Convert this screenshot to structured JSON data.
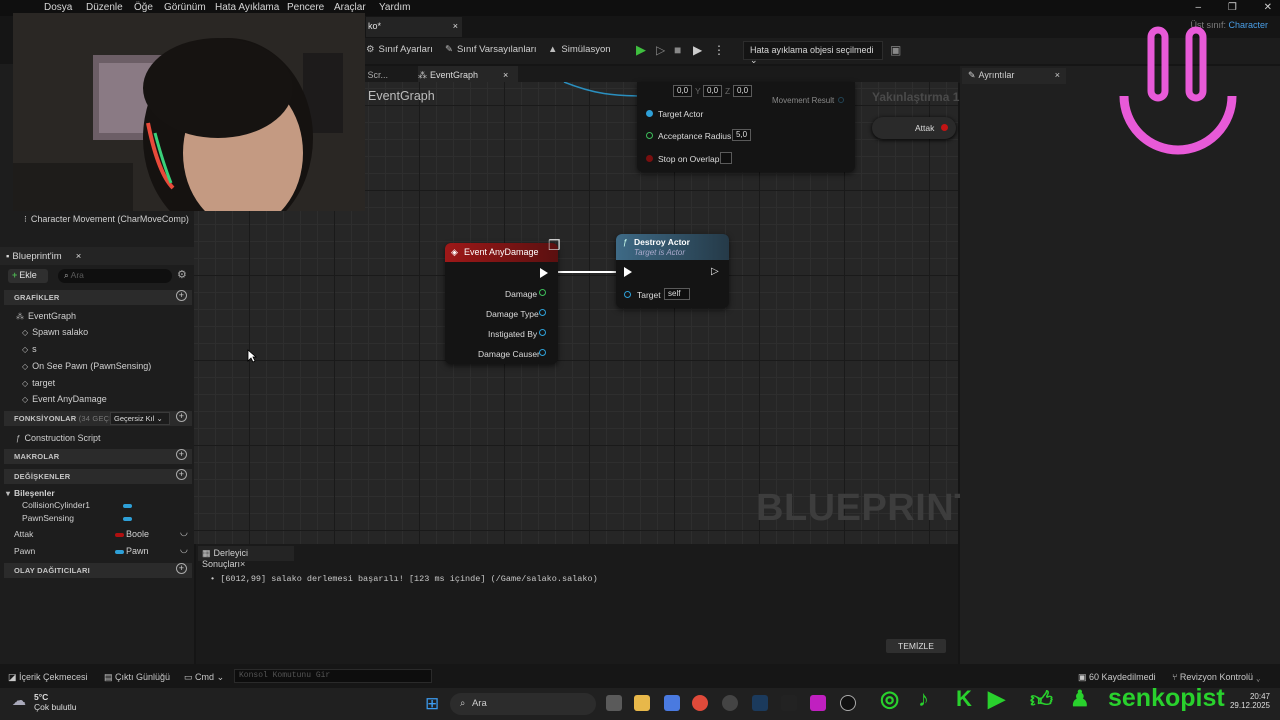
{
  "menu": [
    "Dosya",
    "Düzenle",
    "Öğe",
    "Görünüm",
    "Hata Ayıklama",
    "Pencere",
    "Araçlar",
    "Yardım"
  ],
  "window_controls": [
    "–",
    "❐",
    "✕"
  ],
  "parent_class": {
    "label": "Üst sınıf:",
    "value": "Character"
  },
  "doc_tab": {
    "label": "ko*",
    "close": "×"
  },
  "toolbar": {
    "class_settings": "Sınıf Ayarları",
    "class_defaults": "Sınıf Varsayılanları",
    "simulation": "Simülasyon",
    "debug_object": "Hata ayıklama objesi seçilmedi"
  },
  "graph_tabs": {
    "construction": "n Scr...",
    "active": "EventGraph",
    "close": "×"
  },
  "graph": {
    "title": "EventGraph",
    "zoom": "Yakınlaştırma 1:1",
    "watermark": "BLUEPRINT"
  },
  "nodes": {
    "move_to": {
      "coords": [
        "0,0",
        "0,0",
        "0,0"
      ],
      "coord_axes": [
        "X",
        "Y",
        "Z"
      ],
      "movement_result": "Movement Result",
      "target_actor": "Target Actor",
      "acceptance_radius": "Acceptance Radius",
      "acceptance_value": "5,0",
      "stop_on_overlap": "Stop on Overlap"
    },
    "attak": "Attak",
    "event_any_damage": {
      "title": "Event AnyDamage",
      "pins": [
        "Damage",
        "Damage Type",
        "Instigated By",
        "Damage Causer"
      ]
    },
    "destroy_actor": {
      "title": "Destroy Actor",
      "subtitle": "Target is Actor",
      "target_label": "Target",
      "target_value": "self"
    }
  },
  "left": {
    "component": "Character Movement (CharMoveComp)",
    "bp_tab": "Blueprint'im",
    "add": "Ekle",
    "search_placeholder": "Ara",
    "sections": {
      "graphs": "GRAFİKLER",
      "functions": "FONKSİYONLAR",
      "functions_count": "(34 GEÇERSİ",
      "functions_filter": "Geçersiz Kıl",
      "macros": "MAKROLAR",
      "variables": "DEĞİŞKENLER",
      "dispatchers": "OLAY DAĞITICILARI"
    },
    "graph_items": [
      "EventGraph",
      "Spawn salako",
      "s",
      "On See Pawn (PawnSensing)",
      "target",
      "Event AnyDamage"
    ],
    "function_items": [
      "Construction Script"
    ],
    "components_group": "Bileşenler",
    "components": [
      "CollisionCylinder1",
      "PawnSensing"
    ],
    "variables": [
      {
        "name": "Attak",
        "type": "Boole",
        "color": "#b01010"
      },
      {
        "name": "Pawn",
        "type": "Pawn",
        "color": "#2ea0d8"
      }
    ]
  },
  "details": {
    "tab": "Ayrıntılar",
    "close": "×"
  },
  "output": {
    "tab": "Derleyici Sonuçları",
    "close": "×",
    "log": "[6012,99] salako derlemesi başarılı! [123 ms içinde] (/Game/salako.salako)",
    "clear": "TEMİZLE"
  },
  "statusbar": {
    "content_drawer": "İçerik Çekmecesi",
    "output_log": "Çıktı Günlüğü",
    "cmd": "Cmd",
    "console_placeholder": "Konsol Komutunu Gir",
    "saved": "60 Kaydedilmedi",
    "revision": "Revizyon Kontrolü"
  },
  "taskbar": {
    "temp": "5°C",
    "weather": "Çok bulutlu",
    "search": "Ara",
    "time": "20:47",
    "date": "29.12.2025"
  },
  "overlay": {
    "brand": "senkopist"
  },
  "colors": {
    "accent_green": "#29d12d",
    "exec_red": "#b31c1c",
    "pin_blue": "#2ea0d8",
    "pin_green": "#3dbd5a",
    "logo_pink": "#e85ad8"
  }
}
